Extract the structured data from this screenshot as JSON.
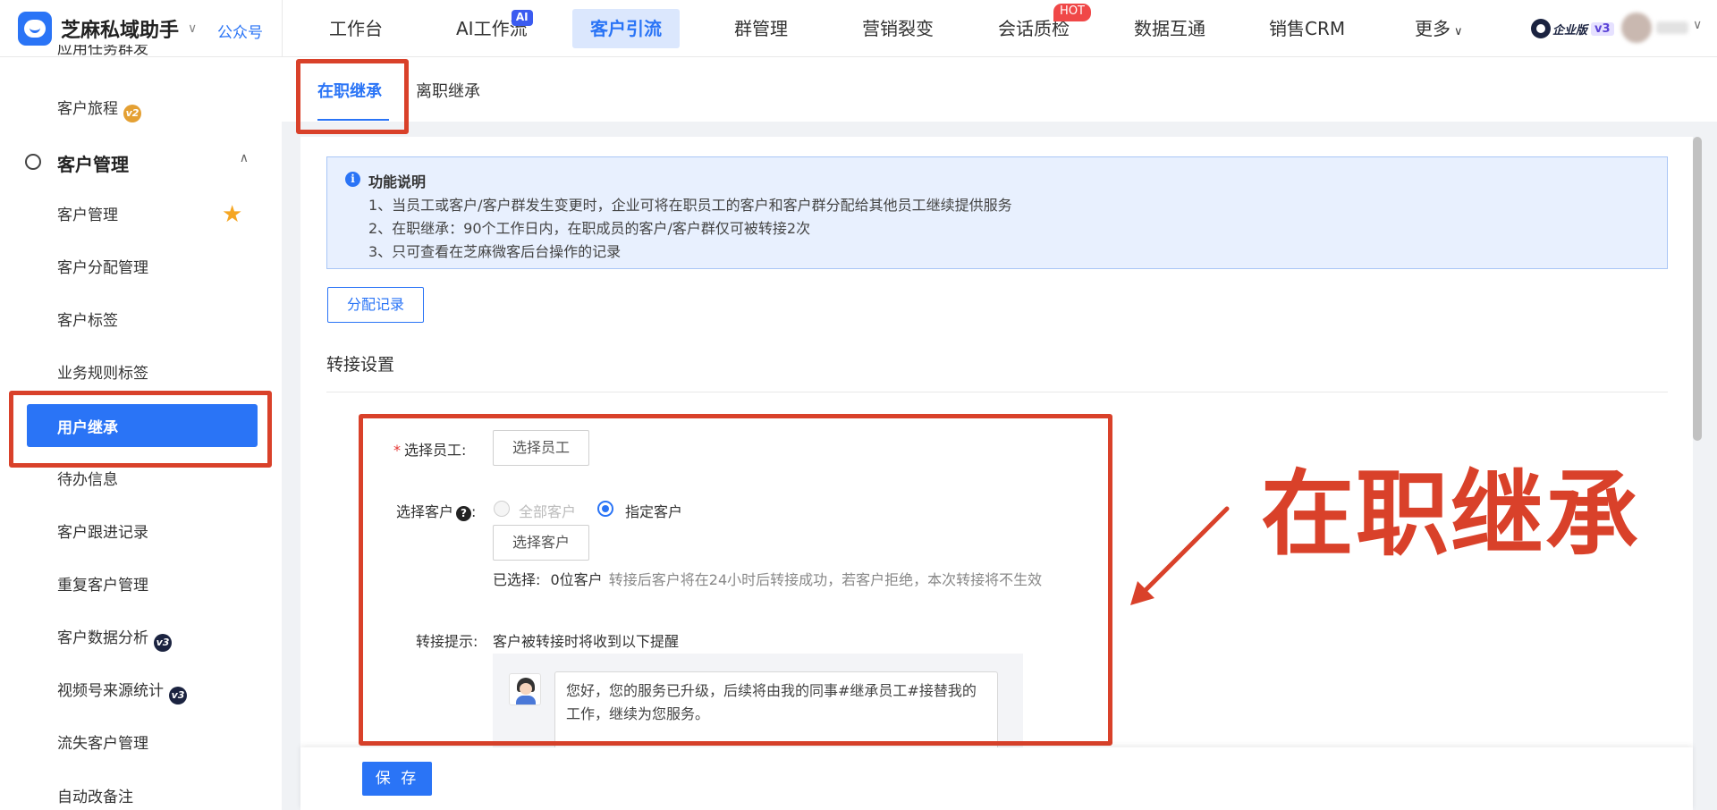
{
  "brand": {
    "name": "芝麻私域助手",
    "caret": "∨",
    "gzh": "公众号"
  },
  "nav": {
    "items": [
      {
        "label": "工作台"
      },
      {
        "label": "AI工作流",
        "badge": "AI"
      },
      {
        "label": "客户引流",
        "active": true
      },
      {
        "label": "群管理"
      },
      {
        "label": "营销裂变"
      },
      {
        "label": "会话质检",
        "badge": "HOT"
      },
      {
        "label": "数据互通"
      },
      {
        "label": "销售CRM"
      },
      {
        "label": "更多",
        "caret": "∨"
      }
    ],
    "edition_label": "企业版",
    "edition_version": "v3"
  },
  "sidebar": {
    "partial_top": "应用任务群发",
    "journey": {
      "label": "客户旅程",
      "badge": "v2"
    },
    "group_title": "客户管理",
    "items": [
      {
        "label": "客户管理",
        "starred": true
      },
      {
        "label": "客户分配管理"
      },
      {
        "label": "客户标签"
      },
      {
        "label": "业务规则标签"
      },
      {
        "label": "用户继承",
        "active": true
      },
      {
        "label": "待办信息"
      },
      {
        "label": "客户跟进记录"
      },
      {
        "label": "重复客户管理"
      },
      {
        "label": "客户数据分析",
        "badge": "v3"
      },
      {
        "label": "视频号来源统计",
        "badge": "v3"
      },
      {
        "label": "流失客户管理"
      },
      {
        "label": "自动改备注"
      }
    ]
  },
  "tabs": [
    {
      "label": "在职继承",
      "active": true
    },
    {
      "label": "离职继承"
    }
  ],
  "notice": {
    "title": "功能说明",
    "lines": [
      "1、当员工或客户/客户群发生变更时，企业可将在职员工的客户和客户群分配给其他员工继续提供服务",
      "2、在职继承：90个工作日内，在职成员的客户/客户群仅可被转接2次",
      "3、只可查看在芝麻微客后台操作的记录"
    ]
  },
  "assign_record_btn": "分配记录",
  "section_title": "转接设置",
  "form": {
    "staff_label": "选择员工:",
    "staff_required": "*",
    "staff_btn": "选择员工",
    "customer_label": "选择客户",
    "customer_help": "?",
    "customer_colon": ":",
    "radio_all": "全部客户",
    "radio_specified": "指定客户",
    "customer_btn": "选择客户",
    "selected_prefix": "已选择:",
    "selected_count": "0位客户",
    "selected_hint": "转接后客户将在24小时后转接成功，若客户拒绝，本次转接将不生效",
    "tip_label": "转接提示:",
    "tip_desc": "客户被转接时将收到以下提醒",
    "tip_message": "您好，您的服务已升级，后续将由我的同事#继承员工#接替我的工作，继续为您服务。"
  },
  "save_btn": "保 存",
  "annotation": {
    "text": "在职继承"
  },
  "colors": {
    "primary": "#2a74f6",
    "annotation_red": "#d9412a",
    "notice_bg": "#e8f0fe"
  }
}
